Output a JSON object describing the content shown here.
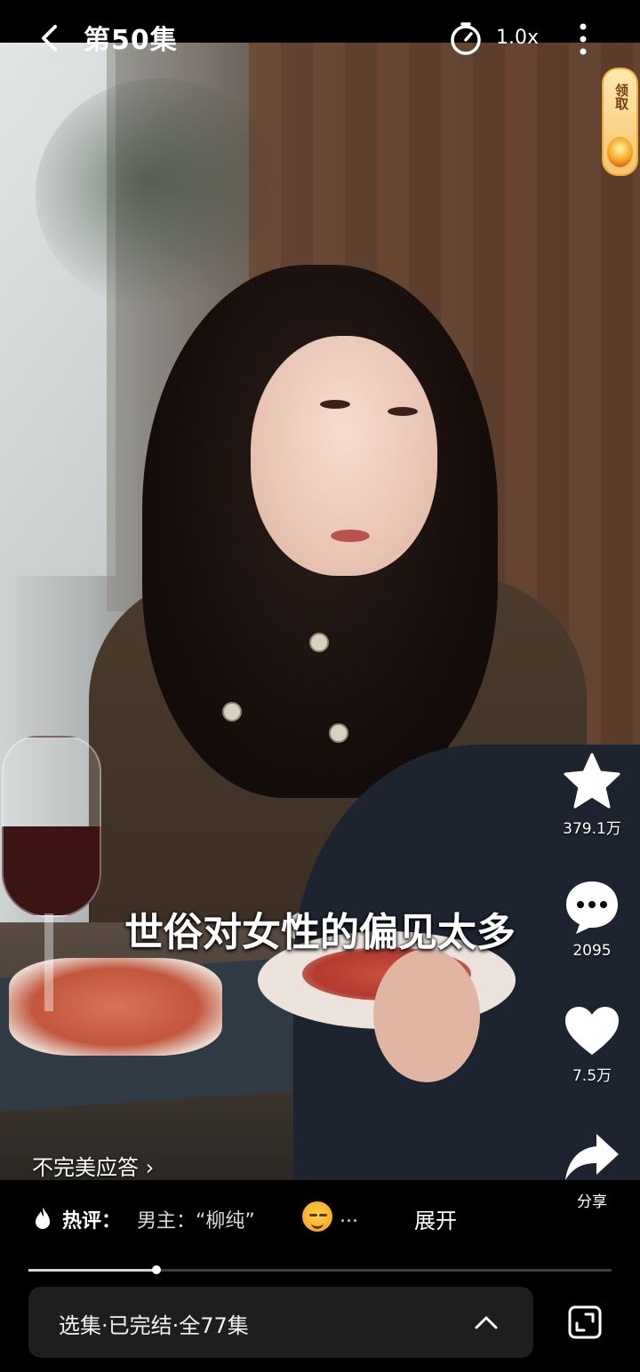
{
  "header": {
    "episode_title": "第50集",
    "speed": "1.0x",
    "icons": [
      "back-icon",
      "timer-icon",
      "more-icon"
    ]
  },
  "reward": {
    "label": "领取"
  },
  "video": {
    "subtitle": "世俗对女性的偏见太多"
  },
  "actions": [
    {
      "icon": "star-icon",
      "label": "379.1万"
    },
    {
      "icon": "comment-icon",
      "label": "2095"
    },
    {
      "icon": "heart-icon",
      "label": "7.5万"
    },
    {
      "icon": "share-icon",
      "label": "分享"
    }
  ],
  "series": {
    "name": "不完美应答",
    "arrow": "›"
  },
  "hot_comment": {
    "label": "热评：",
    "text": "男主：“柳纯”",
    "ellipsis": "...",
    "expand_label": "展开"
  },
  "progress": {
    "value": 0.22
  },
  "episode_bar": {
    "text": "选集·已完结·全77集"
  },
  "colors": {
    "reward_gold": "#f6c46a",
    "panel": "#1e1e1e"
  }
}
